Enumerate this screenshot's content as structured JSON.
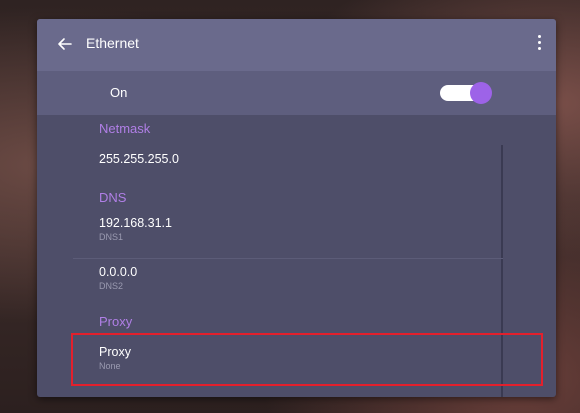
{
  "header": {
    "title": "Ethernet",
    "back_icon": "arrow-left-icon",
    "menu_icon": "more-vert-icon"
  },
  "ethernet_toggle": {
    "label": "On",
    "state": "on",
    "accent_color": "#9d63e8"
  },
  "sections": {
    "netmask": {
      "header": "Netmask",
      "value": "255.255.255.0"
    },
    "dns": {
      "header": "DNS",
      "dns1_value": "192.168.31.1",
      "dns1_label": "DNS1",
      "dns2_value": "0.0.0.0",
      "dns2_label": "DNS2"
    },
    "proxy": {
      "header": "Proxy",
      "title": "Proxy",
      "value": "None"
    }
  },
  "colors": {
    "panel_bg": "#4e4e69",
    "topbar_bg": "#6a6a8c",
    "section_header": "#b07fe6",
    "highlight_border": "#e3202c"
  }
}
